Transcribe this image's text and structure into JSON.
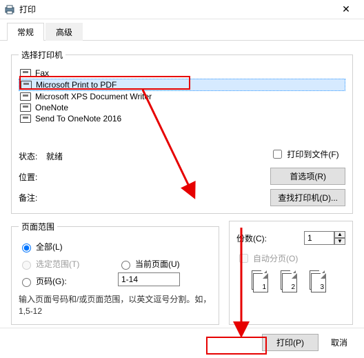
{
  "window": {
    "title": "打印"
  },
  "tabs": {
    "general": "常规",
    "advanced": "高级"
  },
  "printerSection": {
    "legend": "选择打印机",
    "items": [
      {
        "label": "Fax"
      },
      {
        "label": "Microsoft Print to PDF"
      },
      {
        "label": "Microsoft XPS Document Writer"
      },
      {
        "label": "OneNote"
      },
      {
        "label": "Send To OneNote 2016"
      }
    ],
    "status_label": "状态:",
    "status_value": "就绪",
    "location_label": "位置:",
    "comment_label": "备注:",
    "print_to_file": "打印到文件(F)",
    "preferences_btn": "首选项(R)",
    "find_printer_btn": "查找打印机(D)..."
  },
  "range": {
    "legend": "页面范围",
    "all": "全部(L)",
    "selection": "选定范围(T)",
    "current": "当前页面(U)",
    "pages": "页码(G):",
    "pages_value": "1-14",
    "hint": "输入页面号码和/或页面范围，以英文逗号分割。如，1,5-12"
  },
  "copies": {
    "count_label": "份数(C):",
    "count_value": "1",
    "collate": "自动分页(O)",
    "icons": [
      "1",
      "1",
      "2",
      "2",
      "3",
      "3"
    ]
  },
  "footer": {
    "print": "打印(P)",
    "cancel": "取消"
  }
}
